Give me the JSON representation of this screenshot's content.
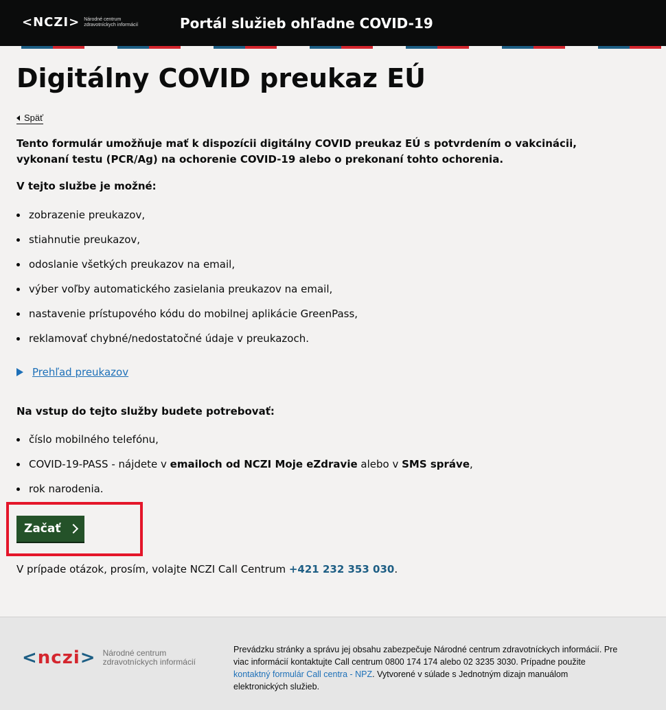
{
  "header": {
    "logo_mark": "<NCZI>",
    "logo_sub_1": "Národné centrum",
    "logo_sub_2": "zdravotníckych informácií",
    "title": "Portál služieb ohľadne COVID-19"
  },
  "page": {
    "title": "Digitálny COVID preukaz EÚ",
    "back_label": "Späť",
    "intro": "Tento formulár umožňuje mať k dispozícii digitálny COVID preukaz EÚ s potvrdením o vakcinácii, vykonaní testu (PCR/Ag) na ochorenie COVID-19 alebo o prekonaní tohto ochorenia.",
    "services_heading": "V tejto službe je možné:",
    "services": [
      "zobrazenie preukazov,",
      "stiahnutie preukazov,",
      "odoslanie všetkých preukazov na email,",
      "výber voľby automatického zasielania preukazov na email,",
      "nastavenie prístupového kódu do mobilnej aplikácie GreenPass,",
      "reklamovať chybné/nedostatočné údaje v preukazoch."
    ],
    "details_label": "Prehľad preukazov",
    "needs_heading": "Na vstup do tejto služby budete potrebovať:",
    "needs": {
      "item1": "číslo mobilného telefónu,",
      "item2_pre": "COVID-19-PASS - nájdete v ",
      "item2_b1": "emailoch od NCZI Moje eZdravie",
      "item2_mid": " alebo v ",
      "item2_b2": "SMS správe",
      "item2_post": ",",
      "item3": "rok narodenia."
    },
    "start_label": "Začať",
    "contact_pre": "V prípade otázok, prosím, volajte NCZI Call Centrum ",
    "contact_phone": "+421 232 353 030",
    "contact_post": "."
  },
  "footer": {
    "logo_mark_open": "<",
    "logo_mark_text": "nczi",
    "logo_mark_close": ">",
    "logo_sub_1": "Národné centrum",
    "logo_sub_2": "zdravotníckych informácií",
    "text_pre": "Prevádzku stránky a správu jej obsahu zabezpečuje Národné centrum zdravotníckych informácií. Pre viac informácií kontaktujte Call centrum 0800 174 174 alebo 02 3235 3030. Prípadne použite ",
    "text_link": "kontaktný formulár Call centra - NPZ",
    "text_post": ". Vytvorené v súlade s Jednotným dizajn manuálom elektronických služieb."
  },
  "colors": {
    "header_bg": "#0b0c0c",
    "stripe_blue": "#1d5e84",
    "stripe_red": "#d4262e",
    "link": "#1d70b8",
    "start_button": "#245229",
    "highlight_box": "#e4162a"
  }
}
